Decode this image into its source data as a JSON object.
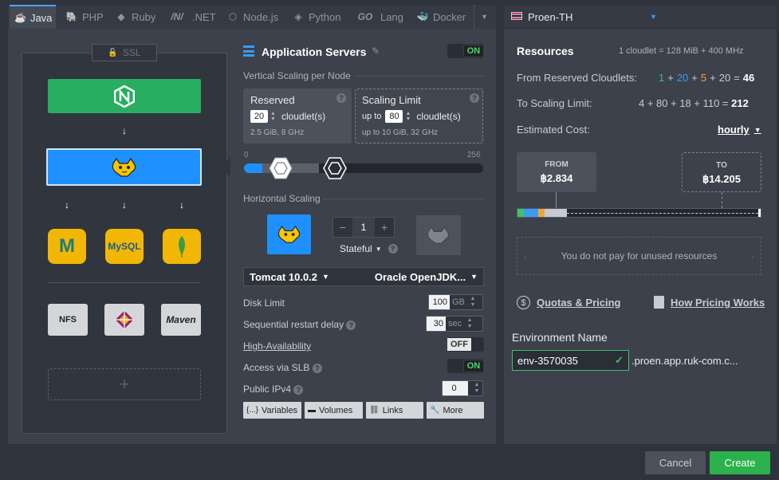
{
  "tabs": [
    {
      "label": "Java",
      "icon": "java-icon",
      "active": true
    },
    {
      "label": "PHP",
      "icon": "php-icon"
    },
    {
      "label": "Ruby",
      "icon": "ruby-icon"
    },
    {
      "label": ".NET",
      "icon": "dotnet-icon"
    },
    {
      "label": "Node.js",
      "icon": "nodejs-icon"
    },
    {
      "label": "Python",
      "icon": "python-icon"
    },
    {
      "label": "Lang",
      "icon": "go-icon",
      "logo_text": "GO"
    },
    {
      "label": "Docker",
      "icon": "docker-icon"
    }
  ],
  "topology": {
    "ssl_label": "SSL",
    "db_nodes": [
      {
        "label": "M",
        "name": "mariadb"
      },
      {
        "label": "MySQL",
        "name": "mysql"
      },
      {
        "label": "",
        "name": "mongodb"
      }
    ],
    "storage_nodes": [
      {
        "label": "NFS"
      },
      {
        "label": ""
      },
      {
        "label": "Maven"
      }
    ],
    "add_label": "+"
  },
  "config": {
    "title": "Application Servers",
    "title_toggle": "ON",
    "vertical_title": "Vertical Scaling per Node",
    "reserved": {
      "title": "Reserved",
      "value": "20",
      "unit": "cloudlet(s)",
      "sub": "2.5 GiB, 8 GHz"
    },
    "limit": {
      "title": "Scaling Limit",
      "prefix": "up to",
      "value": "80",
      "unit": "cloudlet(s)",
      "sub_prefix": "up to",
      "sub": "10 GiB, 32 GHz"
    },
    "slider_min": "0",
    "slider_max": "256",
    "slider_reserved": 20,
    "slider_limit": 80,
    "slider_range": 256,
    "horizontal_title": "Horizontal Scaling",
    "node_count": "1",
    "stateful_label": "Stateful",
    "server_select": "Tomcat 10.0.2",
    "jdk_select": "Oracle OpenJDK...",
    "disk_limit": {
      "label": "Disk Limit",
      "value": "100",
      "unit": "GB"
    },
    "restart_delay": {
      "label": "Sequential restart delay",
      "value": "30",
      "unit": "sec"
    },
    "ha": {
      "label": "High-Availability",
      "state": "OFF"
    },
    "slb": {
      "label": "Access via SLB",
      "state": "ON"
    },
    "ipv4": {
      "label": "Public IPv4",
      "value": "0"
    },
    "buttons": [
      {
        "label": "Variables",
        "icon": "braces-icon",
        "glyph": "{...}"
      },
      {
        "label": "Volumes",
        "icon": "folder-icon",
        "glyph": "▬"
      },
      {
        "label": "Links",
        "icon": "link-icon",
        "glyph": "⛓"
      },
      {
        "label": "More",
        "icon": "wrench-icon",
        "glyph": "🔧"
      }
    ]
  },
  "right": {
    "region": "Proen-TH",
    "resources_title": "Resources",
    "cloudlet_def": "1 cloudlet = 128 MiB + 400 MHz",
    "reserved_label": "From Reserved Cloudlets:",
    "reserved_terms": [
      "1",
      "+",
      "20",
      "+",
      "5",
      "+",
      "20",
      "="
    ],
    "reserved_total": "46",
    "limit_label": "To Scaling Limit:",
    "limit_expr": "4 + 80 + 18 + 110 =",
    "limit_total": "212",
    "cost_label": "Estimated Cost:",
    "cost_period": "hourly",
    "from_label": "FROM",
    "from_value": "฿2.834",
    "to_label": "TO",
    "to_value": "฿14.205",
    "unused_note": "You do not pay for unused resources",
    "quotas_link": "Quotas & Pricing",
    "pricing_link": "How Pricing Works",
    "env_title": "Environment Name",
    "env_value": "env-3570035",
    "env_domain": ".proen.app.ruk-com.c...",
    "colors": {
      "green": "#3ec26d",
      "blue": "#3a9cf2",
      "orange": "#f2a33a"
    }
  },
  "footer": {
    "cancel": "Cancel",
    "create": "Create"
  }
}
